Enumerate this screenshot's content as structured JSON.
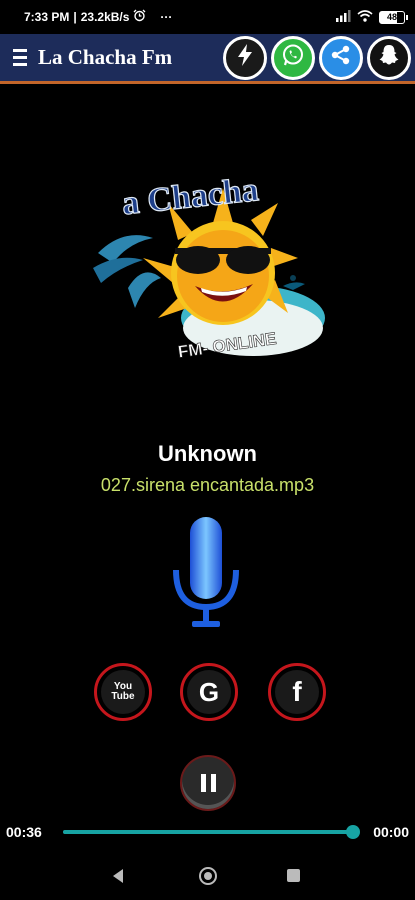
{
  "status_bar": {
    "time": "7:33 PM",
    "speed": "23.2kB/s",
    "more": "···",
    "battery": "48"
  },
  "app_bar": {
    "title": "La Chacha Fm"
  },
  "logo": {
    "brand_top": "a Chacha",
    "brand_bottom": "FM- ONLINE"
  },
  "player": {
    "artist": "Unknown",
    "track": "027.sirena encantada.mp3",
    "elapsed": "00:36",
    "duration": "00:00",
    "progress": 1.0
  },
  "social": {
    "youtube_label": "You Tube",
    "google_label": "G",
    "facebook_label": "f"
  },
  "colors": {
    "app_bar": "#1d2c5a",
    "accent_line": "#c1652a",
    "track_text": "#c8e06a",
    "seek": "#17a3a3",
    "social_ring": "#c4161c"
  }
}
